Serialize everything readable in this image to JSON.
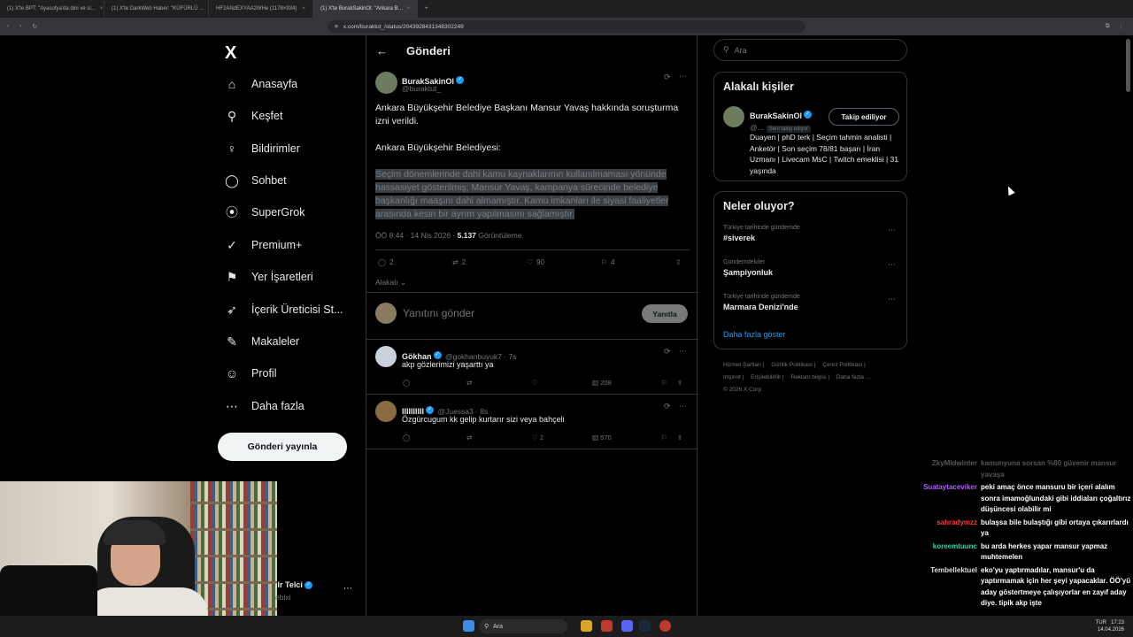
{
  "browser": {
    "tabs": [
      {
        "label": "(1) X'te BPT: \"Ayasofya'da dini ve si…",
        "active": false
      },
      {
        "label": "(1) X'te DarkWeb Haber: \"KÜFÜRLÜ …",
        "active": false
      },
      {
        "label": "HF2ANdEXYAA2WHe (1178×934)",
        "active": false
      },
      {
        "label": "(1) X'te BurakSakinOl: \"Ankara B…",
        "active": true
      }
    ],
    "url": "x.com/buraktut_/status/2043928431348302249"
  },
  "leftnav": {
    "logo": "X",
    "items": [
      {
        "label": "Anasayfa",
        "icon": "home-icon",
        "glyph": "⌂"
      },
      {
        "label": "Keşfet",
        "icon": "search-icon",
        "glyph": "⚲"
      },
      {
        "label": "Bildirimler",
        "icon": "bell-icon",
        "glyph": "♀"
      },
      {
        "label": "Sohbet",
        "icon": "chat-icon",
        "glyph": "◯"
      },
      {
        "label": "SuperGrok",
        "icon": "grok-icon",
        "glyph": "⦿"
      },
      {
        "label": "Premium+",
        "icon": "premium-icon",
        "glyph": "✓"
      },
      {
        "label": "Yer İşaretleri",
        "icon": "bookmark-icon",
        "glyph": "⚑"
      },
      {
        "label": "İçerik Üreticisi St...",
        "icon": "rocket-icon",
        "glyph": "➶"
      },
      {
        "label": "Makaleler",
        "icon": "article-icon",
        "glyph": "✎"
      },
      {
        "label": "Profil",
        "icon": "person-icon",
        "glyph": "☺"
      },
      {
        "label": "Daha fazla",
        "icon": "more-circle-icon",
        "glyph": "⋯"
      }
    ],
    "post_button": "Gönderi yayınla"
  },
  "main": {
    "header_title": "Gönderi",
    "tweet": {
      "name": "BurakSakinOl",
      "handle": "@buraktut_",
      "text1": "Ankara Büyükşehir Belediye Başkanı Mansur Yavaş hakkında soruşturma izni verildi.",
      "text2": "Ankara Büyükşehir Belediyesi:",
      "quote": "Seçim dönemlerinde dahi kamu kaynaklarının kullanılmaması yönünde hassasiyet gösterilmiş; Mansur Yavaş, kampanya sürecinde belediye başkanlığı maaşını dahi almamıştır. Kamu imkanları ile siyasi faaliyetler arasında kesin bir ayrım yapılmasını sağlamıştır.",
      "time": "ÖÖ 8:44 · 14 Nis 2026 ·",
      "views": "5.137",
      "views_label": "Görüntüleme",
      "replies": "2",
      "retweets": "2",
      "likes": "90",
      "bookmarks": "4",
      "related": "Alakalı"
    },
    "reply_placeholder": "Yanıtını gönder",
    "reply_button": "Yanıtla",
    "replies": [
      {
        "name": "Gökhan",
        "handle": "@gokhanbuyuk7 · 7s",
        "text": "akp gözlerimizi yaşarttı ya",
        "likes": "",
        "views": "208"
      },
      {
        "name": "IIIIIIIIII",
        "handle": "@Juessa3 · 8s",
        "text": "Özgürcugum kk gelip kurtarır sizi veya bahçeli",
        "likes": "2",
        "views": "570"
      }
    ]
  },
  "right": {
    "search_placeholder": "Ara",
    "related_title": "Alakalı kişiler",
    "person": {
      "name": "BurakSakinOl",
      "handle": "@...",
      "follows_you": "Seni takip ediyor",
      "follow_button": "Takip ediliyor",
      "bio": "Duayen | phD terk | Seçim tahmin analisti | Anketör | Son seçim 78/81 başarı | İran Uzmanı | Livecam MsC | Twitch emeklisi | 31 yaşında"
    },
    "trends_title": "Neler oluyor?",
    "trends": [
      {
        "context": "Türkiye tarihinde gündemde",
        "title": "#siverek"
      },
      {
        "context": "Gündemdekiler",
        "title": "Şampiyonluk"
      },
      {
        "context": "Türkiye tarihinde gündemde",
        "title": "Marmara Denizi'nde"
      }
    ],
    "show_more": "Daha fazla göster",
    "footer": [
      "Hizmet Şartları |",
      "Gizlilik Politikası |",
      "Çerez Politikası |",
      "Imprint |",
      "Erişilebilirlik |",
      "Reklam bilgisi |",
      "Daha fazla …",
      "© 2026 X Corp."
    ]
  },
  "streamer": {
    "name": "ılr Telci",
    "handle": "ebixi"
  },
  "chat": [
    {
      "user": "ZkyMidwinter",
      "color": "#555555",
      "text": "kamunyuna sorsan %80 güvenir mansur yavaşa"
    },
    {
      "user": "Suataytaceviker",
      "color": "#b05cff",
      "text": "peki amaç önce mansuru bir içeri alalım sonra imamoğlundaki gibi iddiaları çoğaltırız düşüncesi olabilir mi"
    },
    {
      "user": "sahradymzz",
      "color": "#ff3b3b",
      "text": "bulaşsa bile bulaştığı gibi ortaya çıkarırlardı ya"
    },
    {
      "user": "koreemtuunc",
      "color": "#2fd6b0",
      "text": "bu arda herkes yapar mansur yapmaz muhtemelen"
    },
    {
      "user": "Tembellektuel",
      "color": "#dddddd",
      "text": "eko'yu yaptırmadılar, mansur'u da yaptırmamak için her şeyi yapacaklar. ÖÖ'yü aday göstertmeye çalışıyorlar en zayıf aday diye. tipik akp işte"
    }
  ],
  "taskbar": {
    "search": "Ara",
    "lang": "TUR",
    "time": "17:23",
    "date": "14.04.2026"
  }
}
